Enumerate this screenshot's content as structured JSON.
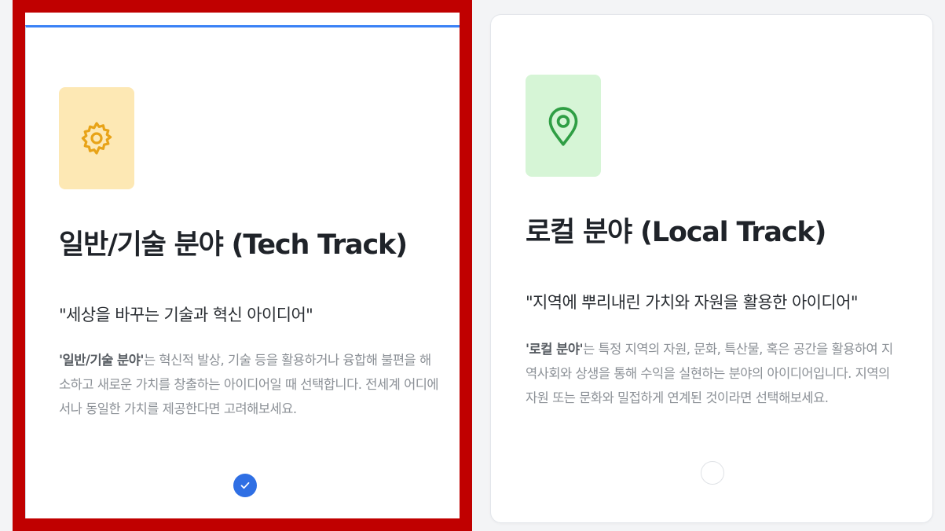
{
  "tracks": [
    {
      "id": "tech",
      "title": "일반/기술 분야 (Tech Track)",
      "tagline": "\"세상을 바꾸는 기술과 혁신 아이디어\"",
      "desc_bold": "'일반/기술 분야'",
      "desc_rest": "는 혁신적 발상, 기술 등을 활용하거나 융합해 불편을 해소하고 새로운 가치를 창출하는 아이디어일 때 선택합니다. 전세계 어디에서나 동일한 가치를 제공한다면 고려해보세요.",
      "icon": "gear-icon",
      "icon_bg": "#fde8b4",
      "icon_color": "#e8a317",
      "selected": true
    },
    {
      "id": "local",
      "title": "로컬 분야 (Local Track)",
      "tagline": "\"지역에 뿌리내린 가치와 자원을 활용한 아이디어\"",
      "desc_bold": "'로컬 분야'",
      "desc_rest": "는 특정 지역의 자원, 문화, 특산물, 혹은 공간을 활용하여 지역사회와 상생을 통해 수익을 실현하는 분야의 아이디어입니다. 지역의 자원 또는 문화와 밀접하게 연계된 것이라면 선택해보세요.",
      "icon": "location-pin-icon",
      "icon_bg": "#d6f5d6",
      "icon_color": "#2f9e44",
      "selected": false
    }
  ],
  "colors": {
    "selected_outline": "#c00000",
    "check_blue": "#2f6fe4"
  }
}
